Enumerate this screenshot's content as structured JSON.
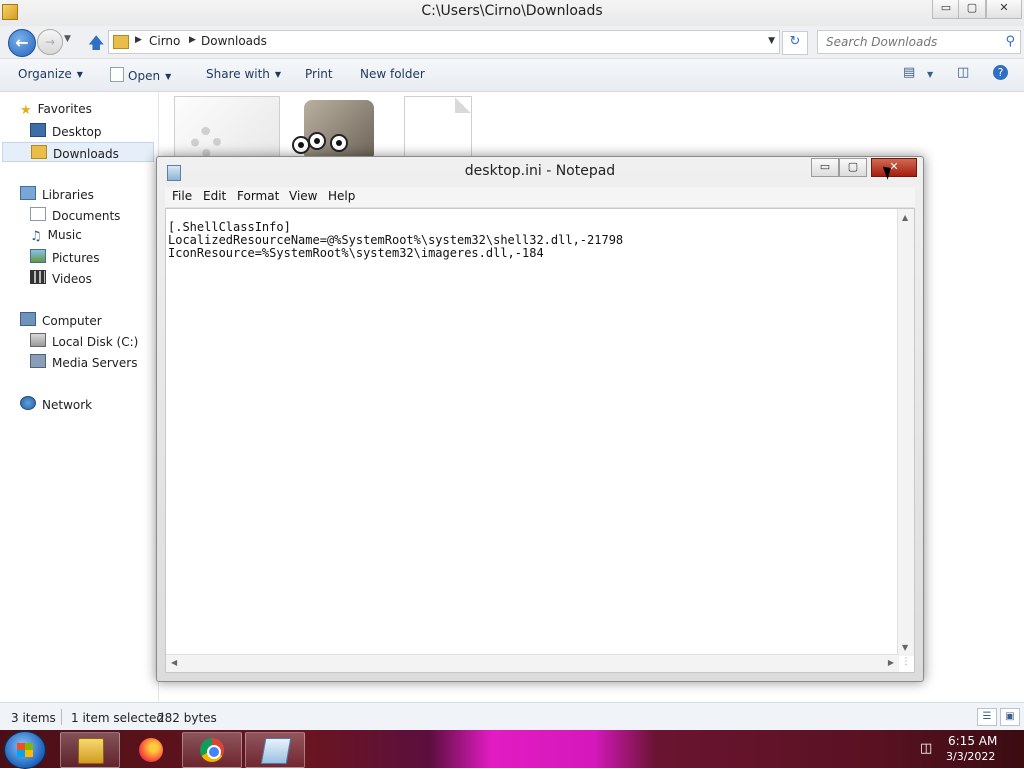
{
  "explorer": {
    "title": "C:\\Users\\Cirno\\Downloads",
    "caption": {
      "minimize": "▭",
      "maximize": "▢",
      "close": "✕"
    },
    "address": {
      "crumbs": [
        "Cirno",
        "Downloads"
      ]
    },
    "search": {
      "placeholder": "Search Downloads"
    },
    "toolbar": {
      "organize": "Organize",
      "open": "Open",
      "share_with": "Share with",
      "print": "Print",
      "new_folder": "New folder"
    },
    "nav": {
      "favorites": "Favorites",
      "desktop": "Desktop",
      "downloads": "Downloads",
      "libraries": "Libraries",
      "documents": "Documents",
      "music": "Music",
      "pictures": "Pictures",
      "videos": "Videos",
      "computer": "Computer",
      "local_disk": "Local Disk (C:)",
      "media_servers": "Media Servers",
      "network": "Network"
    },
    "status": {
      "item_count": "3 items",
      "selection": "1 item selected",
      "size": "282 bytes"
    }
  },
  "notepad": {
    "title": "desktop.ini - Notepad",
    "menu": [
      "File",
      "Edit",
      "Format",
      "View",
      "Help"
    ],
    "content": "[.ShellClassInfo]\nLocalizedResourceName=@%SystemRoot%\\system32\\shell32.dll,-21798\nIconResource=%SystemRoot%\\system32\\imageres.dll,-184"
  },
  "taskbar": {
    "apps": [
      "start-icon",
      "explorer-icon",
      "firefox-icon",
      "chrome-icon",
      "notepad-icon"
    ],
    "clock": {
      "time": "6:15 AM",
      "date": "3/3/2022"
    }
  }
}
